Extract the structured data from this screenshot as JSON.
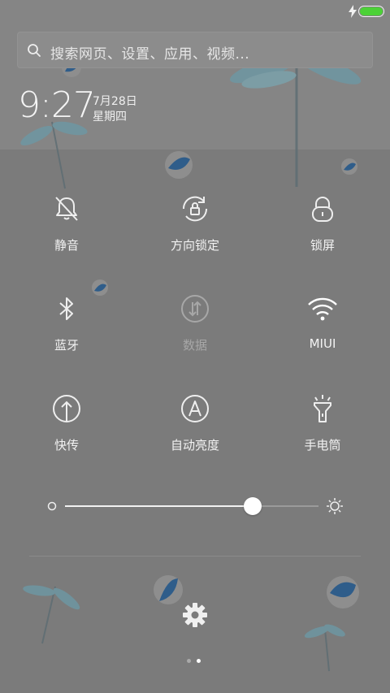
{
  "status_bar": {
    "charging_icon": "lightning-icon",
    "battery_icon": "battery-icon",
    "battery_color": "#4cd137"
  },
  "search": {
    "placeholder": "搜索网页、设置、应用、视频..."
  },
  "clock": {
    "time": "9:27",
    "date": "7月28日",
    "weekday": "星期四"
  },
  "toggles": [
    {
      "label": "静音",
      "icon": "bell-off-icon",
      "active": false
    },
    {
      "label": "方向锁定",
      "icon": "rotation-lock-icon",
      "active": false
    },
    {
      "label": "锁屏",
      "icon": "lock-icon",
      "active": false
    },
    {
      "label": "蓝牙",
      "icon": "bluetooth-icon",
      "active": false
    },
    {
      "label": "数据",
      "icon": "mobile-data-icon",
      "active": false,
      "disabled": true
    },
    {
      "label": "MIUI",
      "icon": "wifi-icon",
      "active": true
    },
    {
      "label": "快传",
      "icon": "quick-transfer-icon",
      "active": false
    },
    {
      "label": "自动亮度",
      "icon": "auto-brightness-icon",
      "active": false
    },
    {
      "label": "手电筒",
      "icon": "flashlight-icon",
      "active": false
    }
  ],
  "brightness": {
    "level": 0.74,
    "low_icon": "brightness-low-icon",
    "high_icon": "brightness-high-icon"
  },
  "settings": {
    "icon": "gear-icon"
  },
  "pager": {
    "count": 2,
    "active_index": 1
  },
  "colors": {
    "background": "#7b7b7b",
    "foreground": "#f2f2f2",
    "disabled": "#a7a7a7",
    "wallpaper_accent": "#2f5d8a"
  }
}
